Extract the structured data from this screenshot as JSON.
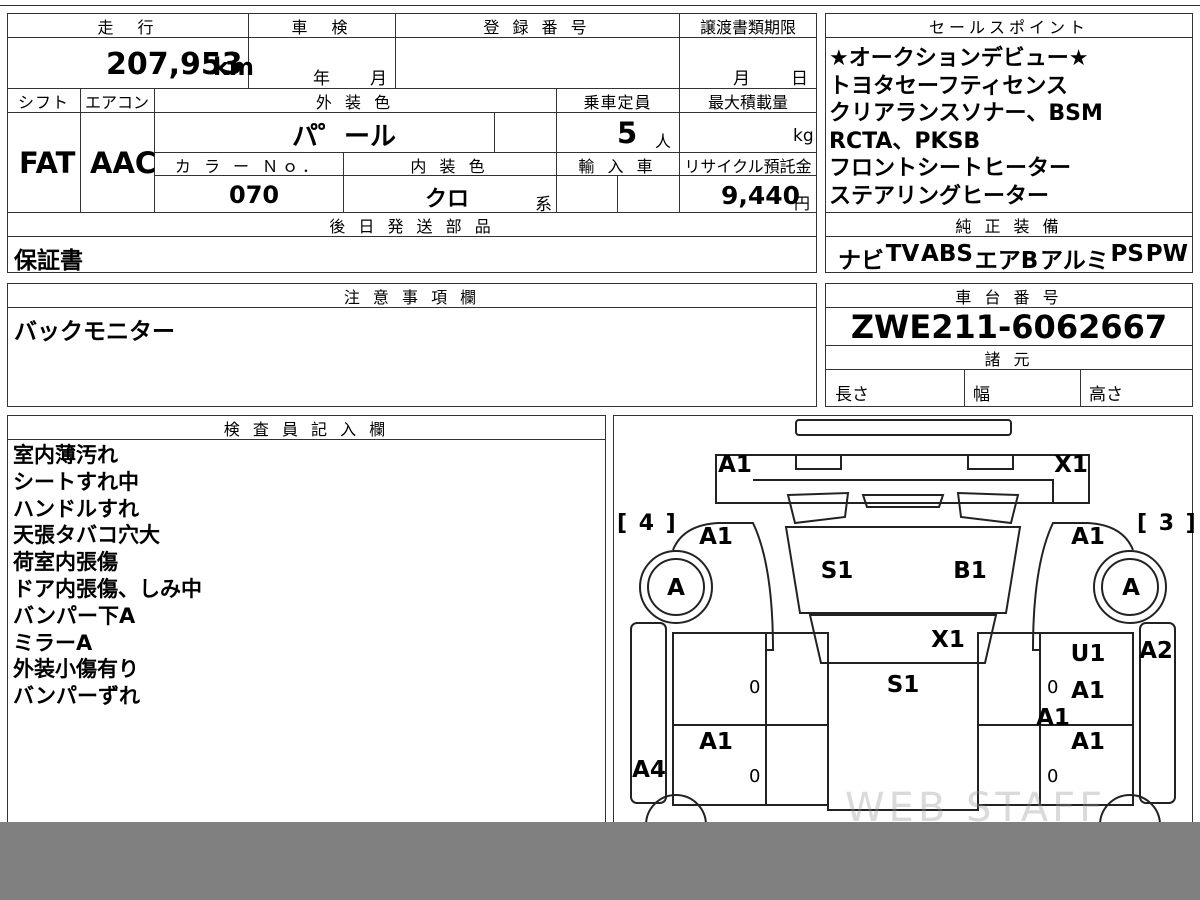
{
  "vehicle": {
    "mileage_label": "走　行",
    "mileage_value": "207,953",
    "mileage_unit": "km",
    "inspection_label": "車　検",
    "inspection_year": "年",
    "inspection_month": "月",
    "registration_label": "登 録 番 号",
    "transfer_label": "譲渡書類期限",
    "transfer_month": "月",
    "transfer_day": "日",
    "shift_label": "シフト",
    "shift_value": "FAT",
    "aircon_label": "エアコン",
    "aircon_value": "AAC",
    "exterior_label": "外 装 色",
    "exterior_value": "パ゜ール",
    "capacity_label": "乗車定員",
    "capacity_value": "5",
    "capacity_unit": "人",
    "max_load_label": "最大積載量",
    "max_load_unit": "kg",
    "color_no_label": "カ ラ ー Ｎｏ．",
    "color_no_value": "070",
    "interior_label": "内 装 色",
    "interior_value": "クロ",
    "interior_suffix": "系",
    "import_label": "輸 入 車",
    "recycle_label": "リサイクル預託金",
    "recycle_value": "9,440",
    "recycle_unit": "円"
  },
  "sales_points": {
    "label": "セールスポイント",
    "items": [
      "★オークションデビュー★",
      "トヨタセーフティセンス",
      "クリアランスソナー、BSM",
      "RCTA、PKSB",
      "フロントシートヒーター",
      "ステアリングヒーター"
    ]
  },
  "later_parts": {
    "label": "後 日 発 送 部 品",
    "value": "保証書"
  },
  "equipment": {
    "label": "純 正 装 備",
    "items": [
      "ナビ",
      "TV",
      "ABS",
      "エアB",
      "アルミ",
      "PS",
      "PW"
    ]
  },
  "notes": {
    "label": "注 意 事 項 欄",
    "text": "バックモニター"
  },
  "chassis": {
    "label": "車 台 番 号",
    "value": "ZWE211-6062667"
  },
  "specs": {
    "label": "諸 元",
    "length_label": "長さ",
    "width_label": "幅",
    "height_label": "高さ"
  },
  "inspector": {
    "label": "検 査 員 記 入 欄",
    "lines": [
      "室内薄汚れ",
      "シートすれ中",
      "ハンドルすれ",
      "天張タバコ穴大",
      "荷室内張傷",
      "ドア内張傷、しみ中",
      "バンパー下A",
      "ミラーA",
      "外装小傷有り",
      "バンパーずれ"
    ]
  },
  "diagram": {
    "left_bracket": "[ 4 ]",
    "right_bracket": "[ 3 ]",
    "codes": {
      "front_left": "A1",
      "front_right": "X1",
      "fender_left": "A1",
      "fender_right": "A1",
      "tire_left": "A",
      "tire_right": "A",
      "windshield_left": "S1",
      "windshield_right": "B1",
      "cowl": "X1",
      "roof": "S1",
      "right_upper": "U1",
      "right_panel": "A2",
      "right_door_front": "A1",
      "right_center": "A1",
      "left_door_rear": "A1",
      "right_door_rear": "A1",
      "left_side": "A4",
      "zero_1": "0",
      "zero_2": "0",
      "zero_3": "0",
      "zero_4": "0"
    },
    "watermark": "WEB STAFF"
  },
  "colors": {
    "line": "#333333",
    "bottom_bar": "#808080"
  }
}
